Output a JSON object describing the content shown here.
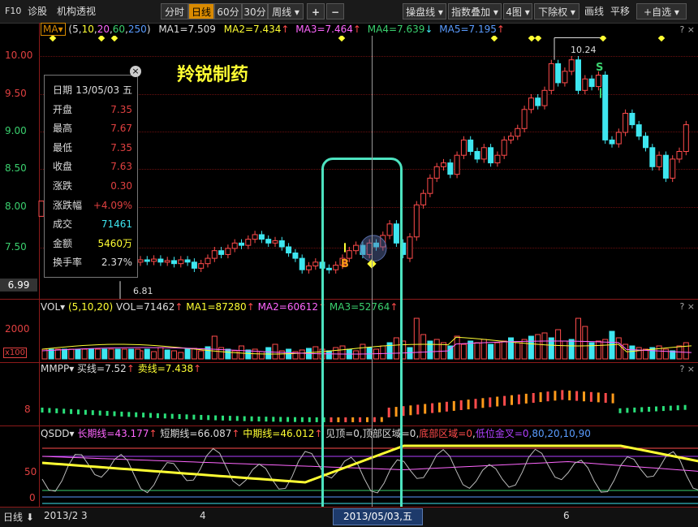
{
  "toolbar": {
    "app_label": "F10",
    "menu_zhengu": "诊股",
    "menu_jigou": "机构透视",
    "tab_fenshi": "分时",
    "tab_rixian": "日线",
    "tab_60": "60分",
    "tab_30": "30分",
    "tab_zhouxian": "周线",
    "zoom_in": "+",
    "zoom_out": "−",
    "pan_line": "操盘线",
    "index_overlay": "指数叠加",
    "four_charts": "4图",
    "ex_rights": "下除权",
    "draw_line": "画线",
    "pan": "平移",
    "custom": "自选"
  },
  "ma_header": {
    "name": "MA",
    "params_open": "(",
    "p1": "5",
    "p2": "10",
    "p3": "20",
    "p4": "60",
    "p5": "250",
    "params_close": ")",
    "ma1": "MA1=7.509",
    "ma2": "MA2=7.434",
    "ma3": "MA3=7.464",
    "ma4": "MA4=7.639",
    "ma5": "MA5=7.195"
  },
  "stock_name": "羚锐制药",
  "price_axis": [
    "10.00",
    "9.50",
    "9.00",
    "8.50",
    "8.00",
    "7.50",
    "6.99"
  ],
  "annotations": {
    "high": "10.24",
    "low": "6.81",
    "buy": "B",
    "sell": "S"
  },
  "infobox": {
    "rows": [
      {
        "k": "日期",
        "v": "13/05/03 五"
      },
      {
        "k": "开盘",
        "v": "7.35"
      },
      {
        "k": "最高",
        "v": "7.67"
      },
      {
        "k": "最低",
        "v": "7.35"
      },
      {
        "k": "收盘",
        "v": "7.63"
      },
      {
        "k": "涨跌",
        "v": "0.30"
      },
      {
        "k": "涨跌幅",
        "v": "+4.09%"
      },
      {
        "k": "成交",
        "v": "71461"
      },
      {
        "k": "金额",
        "v": "5460万"
      },
      {
        "k": "换手率",
        "v": "2.37%"
      }
    ]
  },
  "vol_header": {
    "name": "VOL",
    "params": "(5,10,20)",
    "vol": "VOL=71462",
    "ma1": "MA1=87280",
    "ma2": "MA2=60612",
    "ma3": "MA3=52764"
  },
  "vol_axis": [
    "2000",
    "x100"
  ],
  "mmpp_header": {
    "name": "MMPP",
    "buy": "买线=7.52",
    "sell": "卖线=7.438"
  },
  "mmpp_axis": [
    "8"
  ],
  "qsdd_header": {
    "name": "QSDD",
    "long": "长期线=43.177",
    "short": "短期线=66.087",
    "mid": "中期线=46.012",
    "top": "见顶=0",
    "top_zone": "顶部区域=0",
    "bottom_zone": "底部区域=0",
    "low_cross": "低位金叉=0",
    "levels": ",80,20,10,90"
  },
  "qsdd_axis": [
    "50",
    "0"
  ],
  "corner_labels": {
    "q": "?",
    "x": "×"
  },
  "bottom": {
    "period": "日线",
    "date_start": "2013/2",
    "m3": "3",
    "m4": "4",
    "cursor_date": "2013/05/03,五",
    "m6": "6"
  },
  "colors": {
    "up": "#ff4b4b",
    "down": "#3ee6f0",
    "highlight": "#4de3c0",
    "yellow": "#ffff33",
    "accent": "#d98a00"
  }
}
